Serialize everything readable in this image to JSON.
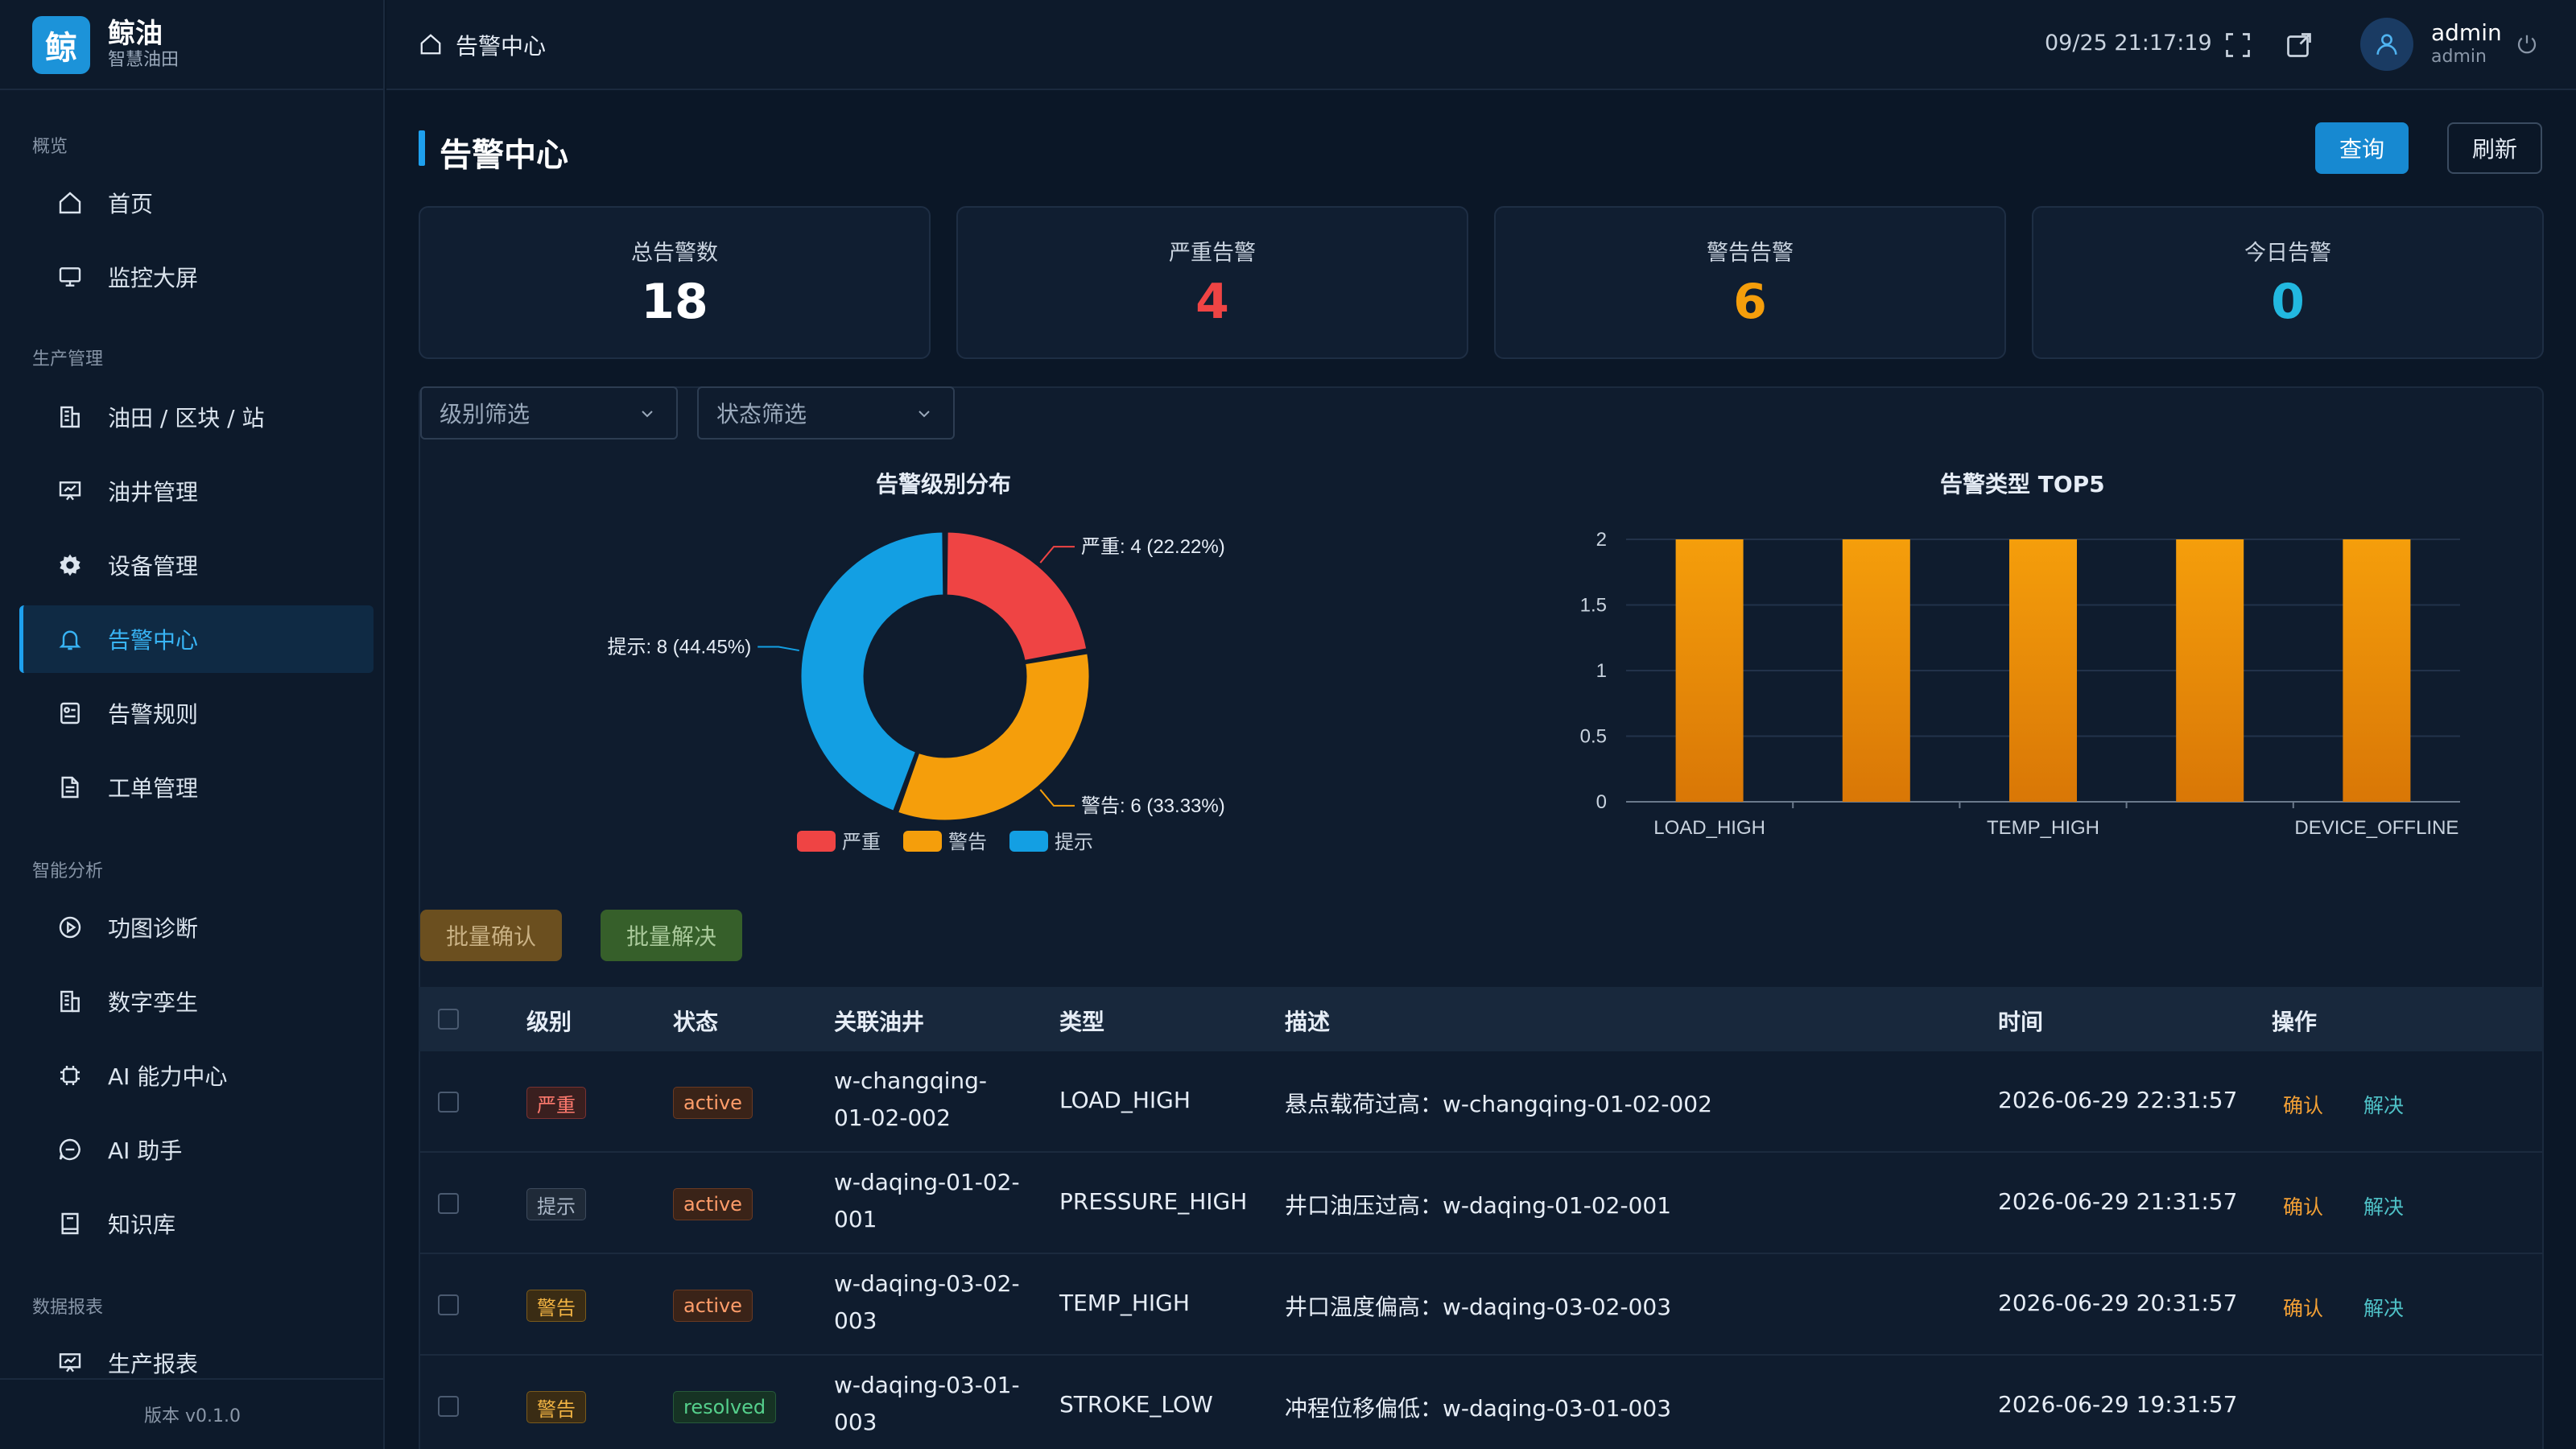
{
  "brand": {
    "logo": "鲸",
    "name": "鲸油",
    "sub": "智慧油田"
  },
  "sidebar": {
    "sections": [
      {
        "title": "概览",
        "items": [
          {
            "label": "首页",
            "icon": "home-icon"
          },
          {
            "label": "监控大屏",
            "icon": "monitor-icon"
          }
        ]
      },
      {
        "title": "生产管理",
        "items": [
          {
            "label": "油田 / 区块 / 站",
            "icon": "building-icon"
          },
          {
            "label": "油井管理",
            "icon": "presentation-icon"
          },
          {
            "label": "设备管理",
            "icon": "gear-icon"
          },
          {
            "label": "告警中心",
            "icon": "bell-icon",
            "active": true
          },
          {
            "label": "告警规则",
            "icon": "rules-icon"
          },
          {
            "label": "工单管理",
            "icon": "document-icon"
          }
        ]
      },
      {
        "title": "智能分析",
        "items": [
          {
            "label": "功图诊断",
            "icon": "play-circle-icon"
          },
          {
            "label": "数字孪生",
            "icon": "building-icon"
          },
          {
            "label": "AI 能力中心",
            "icon": "chip-icon"
          },
          {
            "label": "AI 助手",
            "icon": "chat-icon"
          },
          {
            "label": "知识库",
            "icon": "book-icon"
          }
        ]
      },
      {
        "title": "数据报表",
        "items": [
          {
            "label": "生产报表",
            "icon": "presentation-icon"
          }
        ]
      }
    ],
    "version": "版本 v0.1.0"
  },
  "header": {
    "breadcrumb": "告警中心",
    "datetime": "09/25 21:17:19",
    "user_name": "admin",
    "user_role": "admin"
  },
  "page": {
    "title": "告警中心",
    "query_button": "查询",
    "refresh_button": "刷新"
  },
  "stats": [
    {
      "label": "总告警数",
      "value": "18",
      "color": "#ffffff"
    },
    {
      "label": "严重告警",
      "value": "4",
      "color": "#ef4444"
    },
    {
      "label": "警告告警",
      "value": "6",
      "color": "#f59e0b"
    },
    {
      "label": "今日告警",
      "value": "0",
      "color": "#22b8e0"
    }
  ],
  "filters": {
    "level_placeholder": "级别筛选",
    "status_placeholder": "状态筛选"
  },
  "chart_data": [
    {
      "type": "pie",
      "title": "告警级别分布",
      "slices": [
        {
          "name": "严重",
          "value": 4,
          "label": "严重: 4 (22.22%)",
          "color": "#ef4444"
        },
        {
          "name": "警告",
          "value": 6,
          "label": "警告: 6 (33.33%)",
          "color": "#f59e0b"
        },
        {
          "name": "提示",
          "value": 8,
          "label": "提示: 8 (44.45%)",
          "color": "#139fe3"
        }
      ],
      "legend": "bottom"
    },
    {
      "type": "bar",
      "title": "告警类型 TOP5",
      "categories": [
        "LOAD_HIGH",
        "",
        "TEMP_HIGH",
        "",
        "DEVICE_OFFLINE"
      ],
      "values": [
        2,
        2,
        2,
        2,
        2
      ],
      "ylim": [
        0,
        2
      ],
      "yticks": [
        "0",
        "0.5",
        "1",
        "1.5",
        "2"
      ],
      "color": "#f59e0b",
      "grid": true
    }
  ],
  "bulk": {
    "confirm_label": "批量确认",
    "resolve_label": "批量解决"
  },
  "table": {
    "headers": [
      "级别",
      "状态",
      "关联油井",
      "类型",
      "描述",
      "时间",
      "操作"
    ],
    "rows": [
      {
        "level": "严重",
        "status": "active",
        "well_line1": "w-changqing-",
        "well_line2": "01-02-002",
        "type": "LOAD_HIGH",
        "desc": "悬点载荷过高：w-changqing-01-02-002",
        "time": "2026-06-29 22:31:57",
        "confirm": "确认",
        "resolve": "解决"
      },
      {
        "level": "提示",
        "status": "active",
        "well_line1": "w-daqing-01-02-",
        "well_line2": "001",
        "type": "PRESSURE_HIGH",
        "desc": "井口油压过高：w-daqing-01-02-001",
        "time": "2026-06-29 21:31:57",
        "confirm": "确认",
        "resolve": "解决"
      },
      {
        "level": "警告",
        "status": "active",
        "well_line1": "w-daqing-03-02-",
        "well_line2": "003",
        "type": "TEMP_HIGH",
        "desc": "井口温度偏高：w-daqing-03-02-003",
        "time": "2026-06-29 20:31:57",
        "confirm": "确认",
        "resolve": "解决"
      },
      {
        "level": "警告",
        "status": "resolved",
        "well_line1": "w-daqing-03-01-",
        "well_line2": "003",
        "type": "STROKE_LOW",
        "desc": "冲程位移偏低：w-daqing-03-01-003",
        "time": "2026-06-29 19:31:57",
        "confirm": "",
        "resolve": ""
      }
    ]
  }
}
